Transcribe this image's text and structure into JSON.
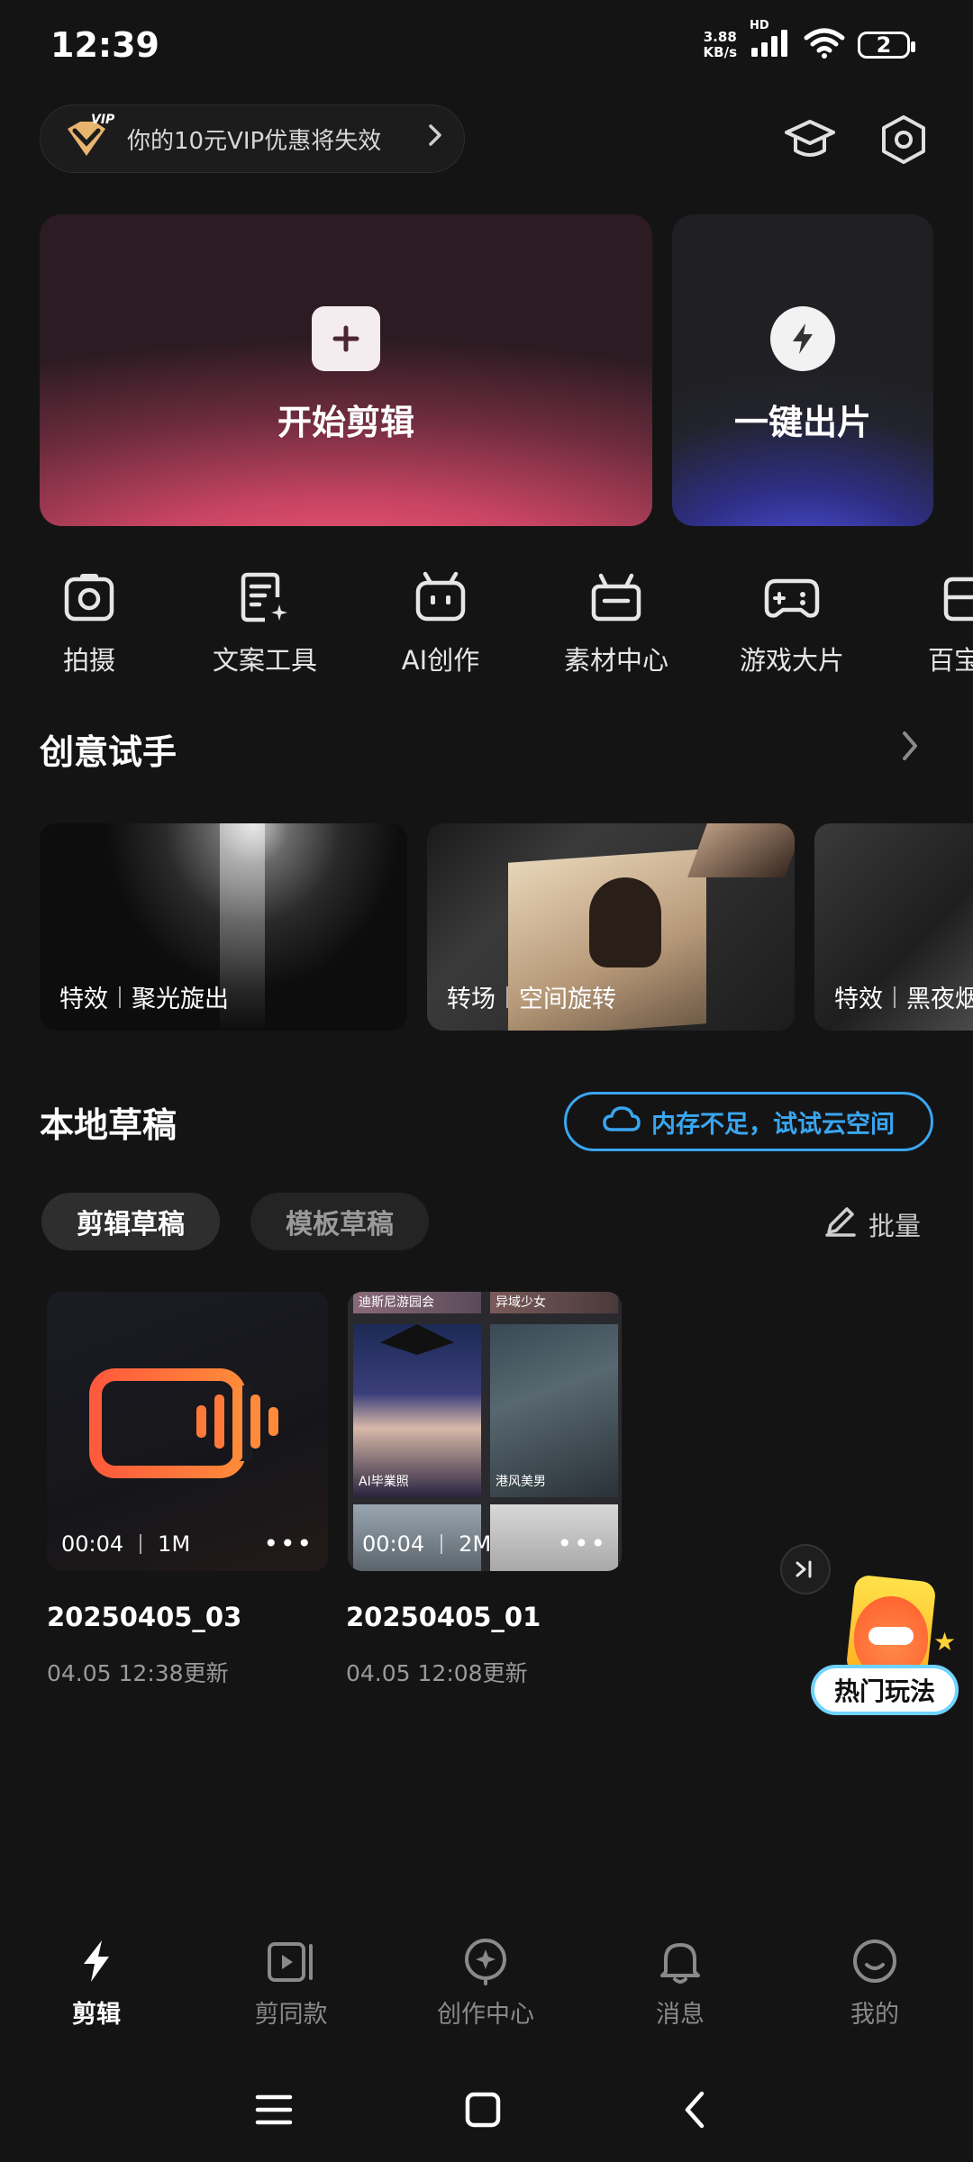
{
  "status_bar": {
    "time": "12:39",
    "net_speed_value": "3.88",
    "net_speed_unit": "KB/s",
    "hd": "HD",
    "battery": "2"
  },
  "vip_banner": {
    "text": "你的10元VIP优惠将失效",
    "badge": "VIP"
  },
  "header_icons": [
    "graduation-cap-icon",
    "settings-hexagon-icon"
  ],
  "cards": {
    "start_edit": {
      "label": "开始剪辑"
    },
    "one_click": {
      "label": "一键出片"
    }
  },
  "tools": [
    {
      "label": "拍摄",
      "icon": "camera-icon"
    },
    {
      "label": "文案工具",
      "icon": "script-tool-icon"
    },
    {
      "label": "AI创作",
      "icon": "ai-robot-icon"
    },
    {
      "label": "素材中心",
      "icon": "material-tv-icon"
    },
    {
      "label": "游戏大片",
      "icon": "gamepad-icon"
    },
    {
      "label": "百宝",
      "icon": "toolbox-icon"
    }
  ],
  "creative": {
    "title": "创意试手",
    "items": [
      {
        "type": "特效",
        "name": "聚光旋出"
      },
      {
        "type": "转场",
        "name": "空间旋转"
      },
      {
        "type": "特效",
        "name": "黑夜烟"
      }
    ]
  },
  "local_drafts": {
    "title": "本地草稿",
    "cloud_button": "内存不足，试试云空间",
    "tabs": [
      "剪辑草稿",
      "模板草稿"
    ],
    "batch": "批量",
    "items": [
      {
        "duration": "00:04",
        "size": "1M",
        "name": "20250405_03",
        "updated": "04.05  12:38更新"
      },
      {
        "duration": "00:04",
        "size": "2M",
        "name": "20250405_01",
        "updated": "04.05  12:08更新",
        "collage_labels": [
          "迪斯尼游园会",
          "异域少女",
          "AI毕業照",
          "港风美男"
        ]
      }
    ]
  },
  "hot_play": {
    "label": "热门玩法"
  },
  "bottom_nav": [
    {
      "label": "剪辑",
      "icon": "lightning-icon",
      "active": true
    },
    {
      "label": "剪同款",
      "icon": "video-template-icon",
      "active": false
    },
    {
      "label": "创作中心",
      "icon": "create-center-icon",
      "active": false
    },
    {
      "label": "消息",
      "icon": "bell-icon",
      "active": false
    },
    {
      "label": "我的",
      "icon": "smile-icon",
      "active": false
    }
  ],
  "colors": {
    "background": "#141414",
    "accent_blue": "#3aa6f0",
    "muted_text": "#9a9a9a"
  }
}
